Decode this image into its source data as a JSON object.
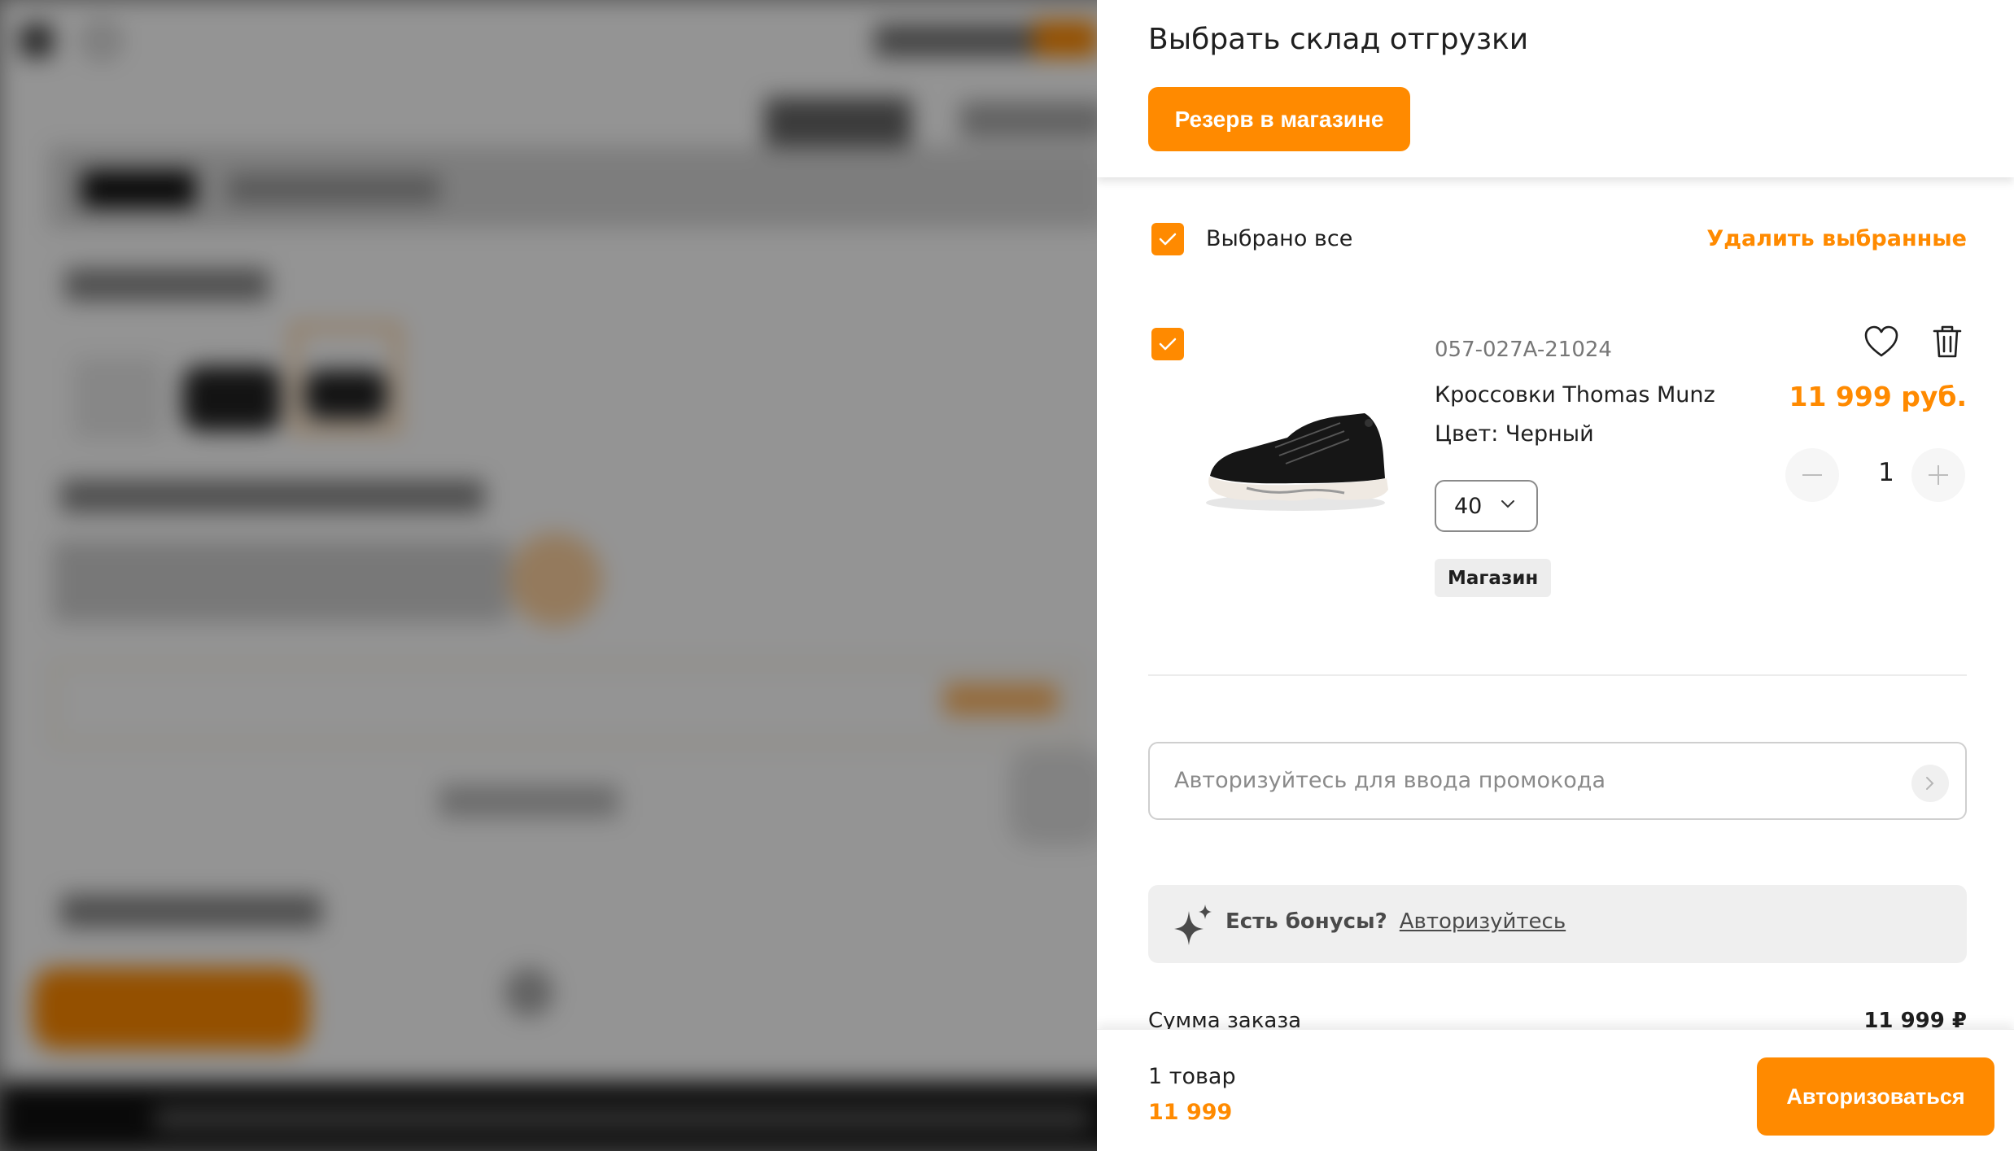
{
  "drawer": {
    "title": "Выбрать склад отгрузки",
    "reserve_button": "Резерв в магазине",
    "select_all_label": "Выбрано все",
    "delete_selected": "Удалить выбранные"
  },
  "product": {
    "sku": "057-027A-21024",
    "name": "Кроссовки Thomas Munz",
    "color": "Цвет: Черный",
    "size": "40",
    "store_tag": "Магазин",
    "price": "11 999 руб.",
    "quantity": "1",
    "icons": [
      "heart-icon",
      "trash-icon",
      "minus-icon",
      "plus-icon",
      "chevron-down-icon"
    ]
  },
  "promo": {
    "placeholder": "Авторизуйтесь для ввода промокода"
  },
  "bonus": {
    "question": "Есть бонусы?",
    "link": "Авторизуйтесь"
  },
  "summary": {
    "label": "Сумма заказа",
    "value": "11 999 ₽"
  },
  "footer": {
    "count": "1 товар",
    "total": "11 999",
    "auth_button": "Авторизоваться"
  },
  "colors": {
    "accent": "#ff8a00",
    "overlay": "#5a5a5a"
  }
}
